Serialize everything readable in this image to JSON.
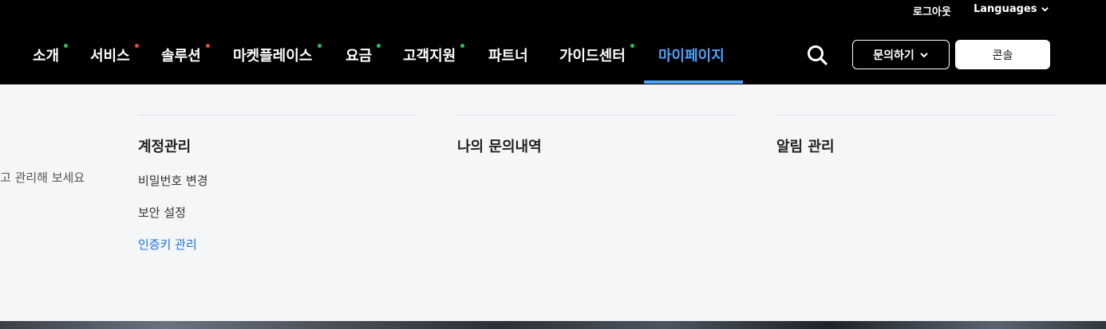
{
  "header": {
    "utility": {
      "logout": "로그아웃",
      "languages": "Languages"
    },
    "nav": [
      {
        "label": "소개",
        "dot": "#22c55e"
      },
      {
        "label": "서비스",
        "dot": "#ef4444"
      },
      {
        "label": "솔루션",
        "dot": "#ef4444"
      },
      {
        "label": "마켓플레이스",
        "dot": "#22c55e"
      },
      {
        "label": "요금",
        "dot": "#22c55e"
      },
      {
        "label": "고객지원",
        "dot": "#22c55e"
      },
      {
        "label": "파트너",
        "dot": null
      },
      {
        "label": "가이드센터",
        "dot": "#22c55e"
      },
      {
        "label": "마이페이지",
        "dot": null,
        "active": true
      }
    ],
    "inquiry_label": "문의하기",
    "console_label": "콘솔"
  },
  "panel": {
    "lead_text": "고 관리해 보세요",
    "columns": [
      {
        "title": "계정관리",
        "items": [
          "비밀번호 변경",
          "보안 설정",
          "인증키 관리"
        ],
        "active_item": "인증키 관리"
      },
      {
        "title": "나의 문의내역",
        "items": []
      },
      {
        "title": "알림 관리",
        "items": []
      }
    ]
  },
  "colors": {
    "accent": "#4da3ff",
    "link_active": "#1a73d9",
    "panel_bg": "#f5f6f8",
    "header_bg": "#000000"
  },
  "icons": {
    "search": "search-icon",
    "chevron": "chevron-down-icon"
  }
}
